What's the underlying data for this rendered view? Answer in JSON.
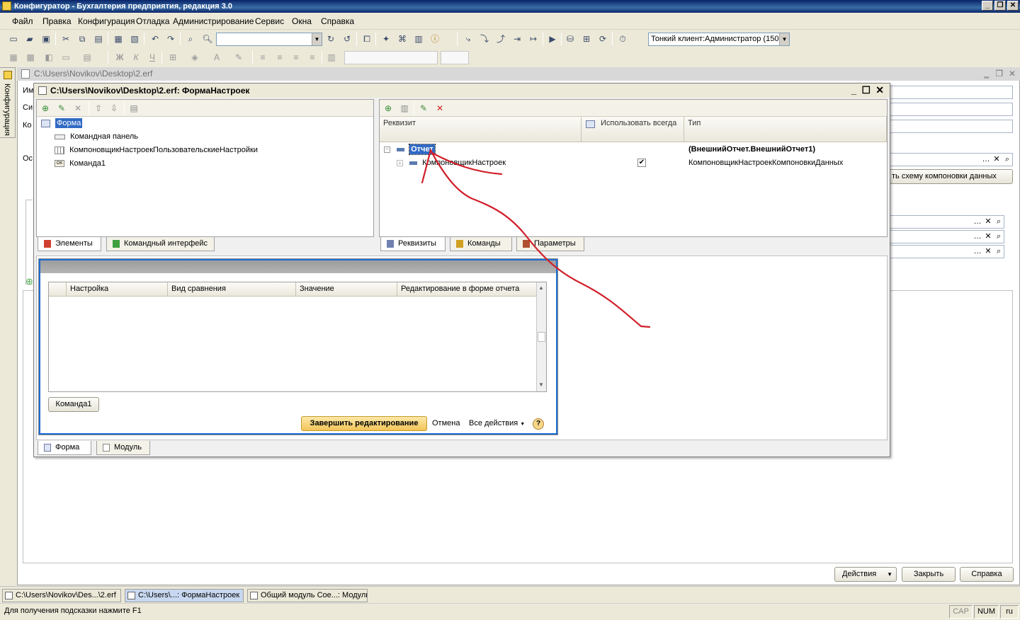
{
  "window": {
    "title": "Конфигуратор - Бухгалтерия предприятия, редакция 3.0"
  },
  "menu": [
    "Файл",
    "Правка",
    "Конфигурация",
    "Отладка",
    "Администрирование",
    "Сервис",
    "Окна",
    "Справка"
  ],
  "toolbar": {
    "search_value": "",
    "client_combo": "Тонкий клиент:Администратор (150"
  },
  "left_tab": {
    "label": "Конфигурация"
  },
  "mdi": {
    "title": "C:\\Users\\Novikov\\Desktop\\2.erf",
    "side_labels": [
      "Им",
      "Си",
      "Ко",
      "Ос"
    ],
    "compose_button": "ть схему компоновки данных"
  },
  "form_window": {
    "title": "C:\\Users\\Novikov\\Desktop\\2.erf: ФормаНастроек",
    "elements_tree": {
      "root": "Форма",
      "items": [
        "Командная панель",
        "КомпоновщикНастроекПользовательскиеНастройки",
        "Команда1"
      ]
    },
    "left_tabs": [
      "Элементы",
      "Командный интерфейс"
    ],
    "attributes": {
      "headers": [
        "Реквизит",
        "Использовать всегда",
        "Тип"
      ],
      "rows": [
        {
          "name": "Отчет",
          "type": "(ВнешнийОтчет.ВнешнийОтчет1)",
          "checked": false
        },
        {
          "name": "КомпоновщикНастроек",
          "type": "КомпоновщикНастроекКомпоновкиДанных",
          "checked": true
        }
      ]
    },
    "right_tabs": [
      "Реквизиты",
      "Команды",
      "Параметры"
    ],
    "bottom_tabs": [
      "Форма",
      "Модуль"
    ]
  },
  "preview": {
    "columns": [
      "Настройка",
      "Вид сравнения",
      "Значение",
      "Редактирование в форме отчета"
    ],
    "command_button": "Команда1",
    "finish_button": "Завершить редактирование",
    "cancel_link": "Отмена",
    "all_actions": "Все действия",
    "help_symbol": "?"
  },
  "mdi_buttons": [
    "Действия",
    "Закрыть",
    "Справка"
  ],
  "taskbar": [
    "C:\\Users\\Novikov\\Des...\\2.erf",
    "C:\\Users\\...: ФормаНастроек",
    "Общий модуль Сое...: Модуль"
  ],
  "status": {
    "hint": "Для получения подсказки нажмите F1",
    "cap": "CAP",
    "num": "NUM",
    "lang": "ru"
  },
  "colors": {
    "annotation": "#d11f2a",
    "selection": "#316ac5",
    "titlebar": "#0a246a"
  }
}
